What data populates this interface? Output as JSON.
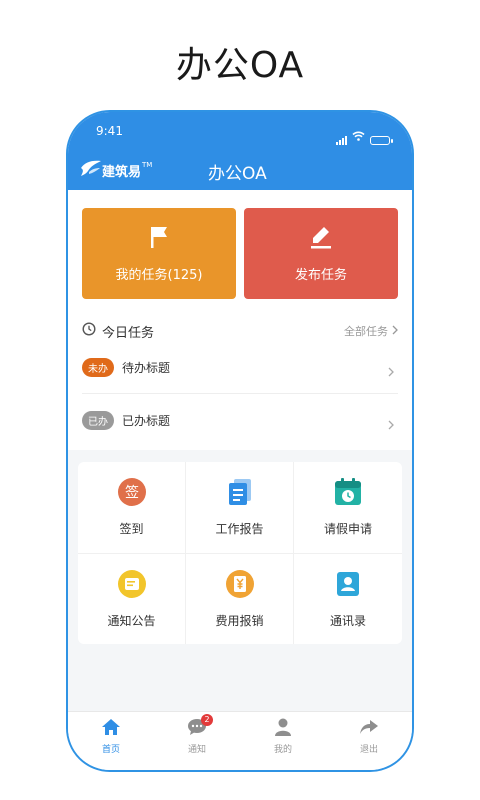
{
  "promo_title": "办公OA",
  "status_bar": {
    "time": "9:41"
  },
  "header": {
    "logo_text": "建筑易",
    "logo_tm": "TM",
    "title": "办公OA"
  },
  "big_cards": [
    {
      "label": "我的任务(125)",
      "icon": "flag-icon",
      "color": "#e9952a"
    },
    {
      "label": "发布任务",
      "icon": "edit-pen-icon",
      "color": "#df5b4c"
    }
  ],
  "today_tasks": {
    "title": "今日任务",
    "all_link": "全部任务",
    "items": [
      {
        "badge": "未办",
        "title": "待办标题",
        "badge_color": "#e06a1a"
      },
      {
        "badge": "已办",
        "title": "已办标题",
        "badge_color": "#9a9a9a"
      }
    ]
  },
  "grid": [
    {
      "label": "签到",
      "icon": "sign-in-icon"
    },
    {
      "label": "工作报告",
      "icon": "report-icon"
    },
    {
      "label": "请假申请",
      "icon": "calendar-clock-icon"
    },
    {
      "label": "通知公告",
      "icon": "notice-icon"
    },
    {
      "label": "费用报销",
      "icon": "expense-icon"
    },
    {
      "label": "通讯录",
      "icon": "contacts-icon"
    }
  ],
  "sign_icon_char": "签",
  "tabbar": {
    "items": [
      {
        "label": "首页",
        "icon": "home-icon",
        "active": true
      },
      {
        "label": "通知",
        "icon": "message-icon",
        "badge": "2"
      },
      {
        "label": "我的",
        "icon": "user-icon"
      },
      {
        "label": "退出",
        "icon": "exit-icon"
      }
    ]
  }
}
